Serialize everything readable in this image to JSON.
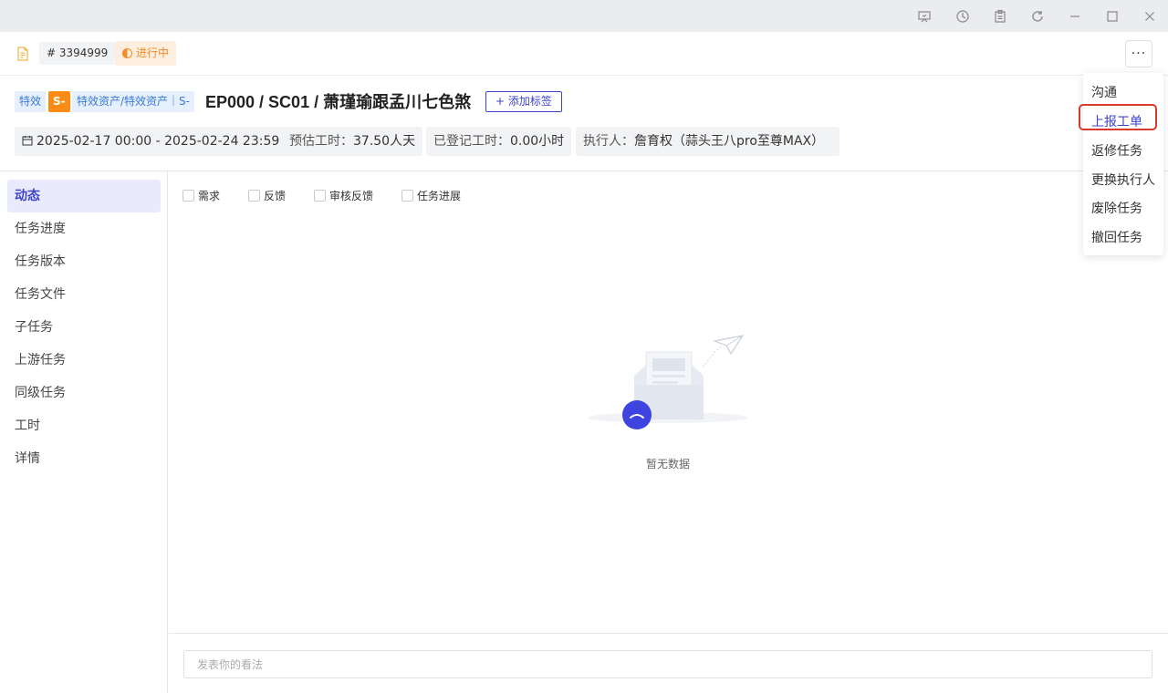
{
  "window": {
    "controls": [
      "presentation-icon",
      "history-icon",
      "clipboard-icon",
      "refresh-icon",
      "minimize-icon",
      "maximize-icon",
      "close-icon"
    ]
  },
  "header": {
    "task_id": "# 3394999",
    "status": "进行中",
    "more_label": "···"
  },
  "task": {
    "tags": [
      "特效",
      "S-",
      "特效资产/特效资产｜S-"
    ],
    "title": "EP000 / SC01 / 萧瑾瑜跟孟川七色煞",
    "add_tag_label": "+ 添加标签",
    "date_range": "2025-02-17 00:00 - 2025-02-24 23:59",
    "estimate_label": "预估工时：",
    "estimate_value": "37.50人天",
    "logged_label": "已登记工时：",
    "logged_value": "0.00小时",
    "assignee_label": "执行人：",
    "assignee_value": "詹育权（蒜头王八pro至尊MAX）"
  },
  "sidebar": {
    "items": [
      {
        "label": "动态",
        "active": true
      },
      {
        "label": "任务进度"
      },
      {
        "label": "任务版本"
      },
      {
        "label": "任务文件"
      },
      {
        "label": "子任务"
      },
      {
        "label": "上游任务"
      },
      {
        "label": "同级任务"
      },
      {
        "label": "工时"
      },
      {
        "label": "详情"
      }
    ]
  },
  "filters": [
    {
      "label": "需求",
      "checked": false
    },
    {
      "label": "反馈",
      "checked": false
    },
    {
      "label": "审核反馈",
      "checked": false
    },
    {
      "label": "任务进展",
      "checked": false
    }
  ],
  "empty_state": {
    "text": "暂无数据"
  },
  "comment": {
    "placeholder": "发表你的看法"
  },
  "dropdown": {
    "items": [
      {
        "label": "沟通"
      },
      {
        "label": "上报工单",
        "highlighted": true
      },
      {
        "label": "返修任务"
      },
      {
        "label": "更换执行人"
      },
      {
        "label": "废除任务"
      },
      {
        "label": "撤回任务"
      }
    ]
  },
  "colors": {
    "accent": "#3d44c9",
    "status_orange": "#f28a28",
    "highlight_red": "#d93a2b"
  }
}
